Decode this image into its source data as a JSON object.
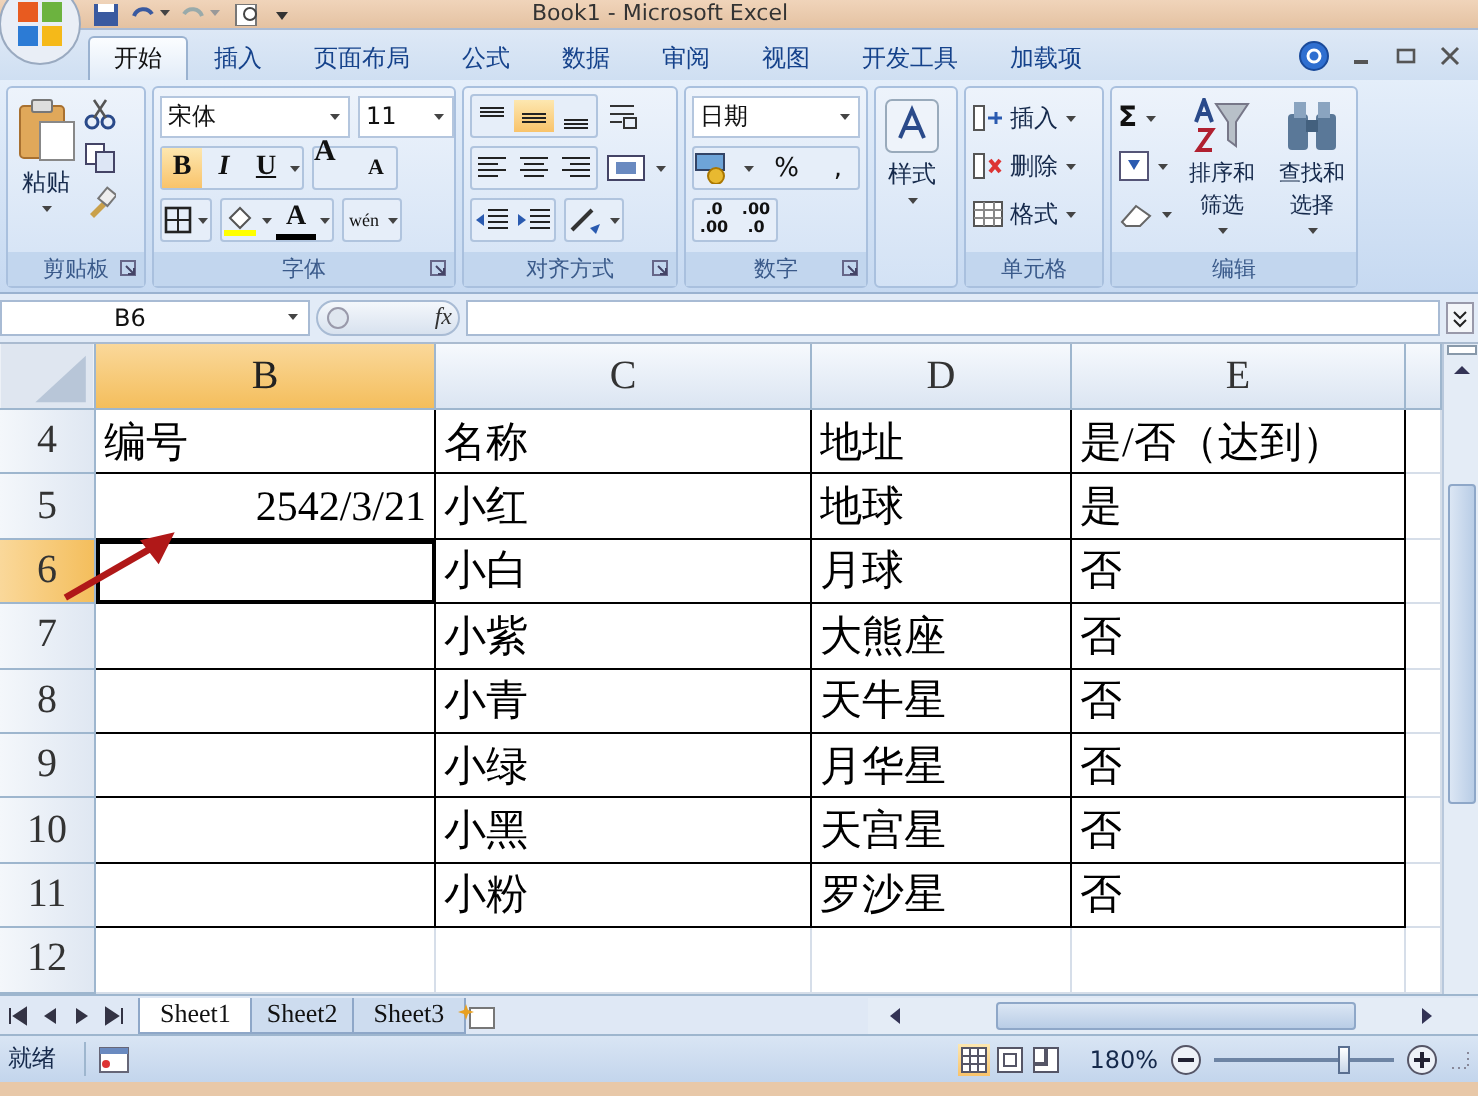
{
  "window": {
    "title": "Book1 - Microsoft Excel"
  },
  "tabs": [
    {
      "label": "开始",
      "selected": true
    },
    {
      "label": "插入",
      "selected": false
    },
    {
      "label": "页面布局",
      "selected": false
    },
    {
      "label": "公式",
      "selected": false
    },
    {
      "label": "数据",
      "selected": false
    },
    {
      "label": "审阅",
      "selected": false
    },
    {
      "label": "视图",
      "selected": false
    },
    {
      "label": "开发工具",
      "selected": false
    },
    {
      "label": "加载项",
      "selected": false
    }
  ],
  "ribbon": {
    "groups": [
      {
        "kind": "clipboard",
        "label": "剪贴板",
        "paste": "粘贴"
      },
      {
        "kind": "font",
        "label": "字体",
        "font_name": "宋体",
        "font_size": "11",
        "toggles": [
          {
            "kind": "bold",
            "label": "B",
            "on": true
          },
          {
            "kind": "italic",
            "label": "I",
            "on": false
          },
          {
            "kind": "underline",
            "label": "U",
            "on": false
          }
        ],
        "grow": "A",
        "shrink": "A",
        "color_letter": "A",
        "phonetic": "wén"
      },
      {
        "kind": "alignment",
        "label": "对齐方式",
        "vertical": [
          {
            "kind": "top",
            "on": false
          },
          {
            "kind": "middle",
            "on": true
          },
          {
            "kind": "bottom",
            "on": false
          }
        ]
      },
      {
        "kind": "number",
        "label": "数字",
        "format": "日期",
        "percent": "%",
        "comma": ",",
        "decimals": [
          [
            ".0",
            ".00"
          ],
          [
            ".00",
            ".0"
          ]
        ]
      },
      {
        "kind": "styles",
        "button": "样式"
      },
      {
        "kind": "cells",
        "label": "单元格",
        "buttons": [
          "插入",
          "删除",
          "格式"
        ]
      },
      {
        "kind": "editing",
        "label": "编辑",
        "sum": "Σ",
        "sort": "排序和筛选",
        "find": "查找和选择"
      }
    ]
  },
  "formula_bar": {
    "name_box": "B6",
    "fx": "fx"
  },
  "columns": [
    {
      "label": "B",
      "selected": true
    },
    {
      "label": "C",
      "selected": false
    },
    {
      "label": "D",
      "selected": false
    },
    {
      "label": "E",
      "selected": false
    }
  ],
  "rows": [
    {
      "number": "4",
      "selected": false,
      "kind": "table",
      "cells": [
        "编号",
        "名称",
        "地址",
        "是/否（达到）"
      ]
    },
    {
      "number": "5",
      "selected": false,
      "kind": "table",
      "cells": [
        "2542/3/21",
        "小红",
        "地球",
        "是"
      ]
    },
    {
      "number": "6",
      "selected": true,
      "kind": "table",
      "cells": [
        "",
        "小白",
        "月球",
        "否"
      ]
    },
    {
      "number": "7",
      "selected": false,
      "kind": "table",
      "cells": [
        "",
        "小紫",
        "大熊座",
        "否"
      ]
    },
    {
      "number": "8",
      "selected": false,
      "kind": "table",
      "cells": [
        "",
        "小青",
        "天牛星",
        "否"
      ]
    },
    {
      "number": "9",
      "selected": false,
      "kind": "table",
      "cells": [
        "",
        "小绿",
        "月华星",
        "否"
      ]
    },
    {
      "number": "10",
      "selected": false,
      "kind": "table",
      "cells": [
        "",
        "小黑",
        "天宫星",
        "否"
      ]
    },
    {
      "number": "11",
      "selected": false,
      "kind": "table",
      "cells": [
        "",
        "小粉",
        "罗沙星",
        "否"
      ]
    },
    {
      "number": "12",
      "selected": false,
      "kind": "blank",
      "cells": [
        "",
        "",
        "",
        ""
      ]
    }
  ],
  "sheet_tabs": [
    {
      "label": "Sheet1",
      "selected": true
    },
    {
      "label": "Sheet2",
      "selected": false
    },
    {
      "label": "Sheet3",
      "selected": false
    }
  ],
  "status_bar": {
    "text": "就绪",
    "views": [
      {
        "kind": "normal",
        "selected": true
      },
      {
        "kind": "layout",
        "selected": false
      },
      {
        "kind": "pagebreak",
        "selected": false
      }
    ],
    "zoom": "180%",
    "zoom_slider": {
      "level": 0.72
    }
  }
}
